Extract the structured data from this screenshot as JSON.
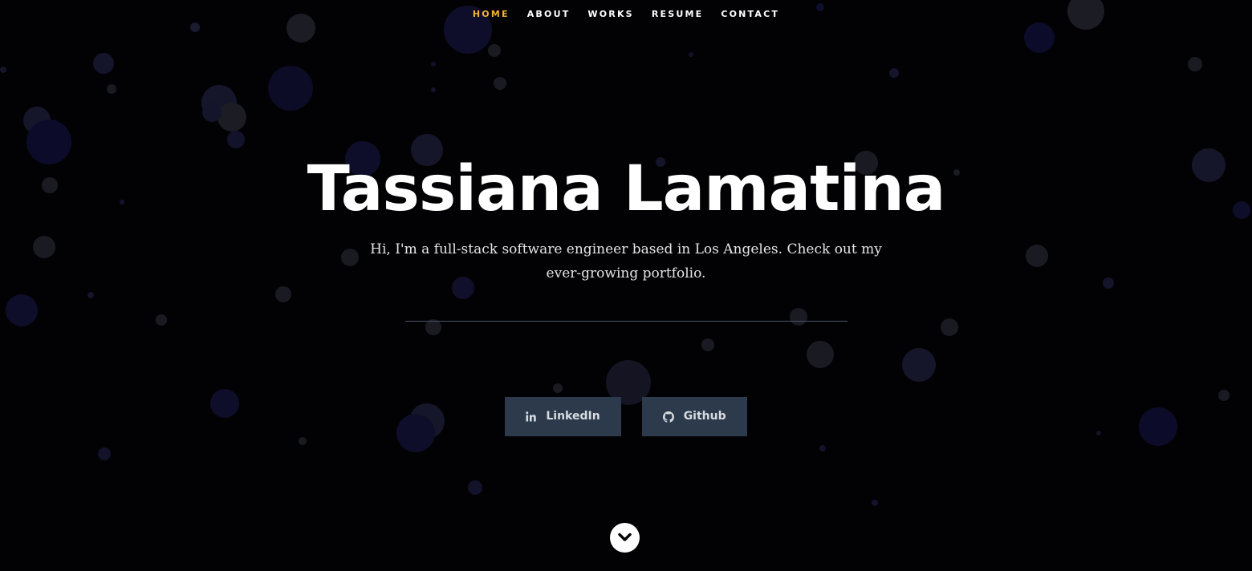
{
  "nav": {
    "items": [
      {
        "label": "HOME",
        "active": true
      },
      {
        "label": "ABOUT",
        "active": false
      },
      {
        "label": "WORKS",
        "active": false
      },
      {
        "label": "RESUME",
        "active": false
      },
      {
        "label": "CONTACT",
        "active": false
      }
    ]
  },
  "hero": {
    "name": "Tassiana Lamatina",
    "tagline": "Hi, I'm a full-stack software engineer based in Los Angeles. Check out my ever-growing portfolio."
  },
  "social": {
    "linkedin": {
      "label": "LinkedIn",
      "icon": "linkedin-icon"
    },
    "github": {
      "label": "Github",
      "icon": "github-icon"
    }
  },
  "scroll": {
    "icon": "chevron-down-icon"
  },
  "colors": {
    "background": "#020205",
    "accent": "#f0b430",
    "button": "#2c3a4b",
    "particle": "#1a1a2e"
  }
}
